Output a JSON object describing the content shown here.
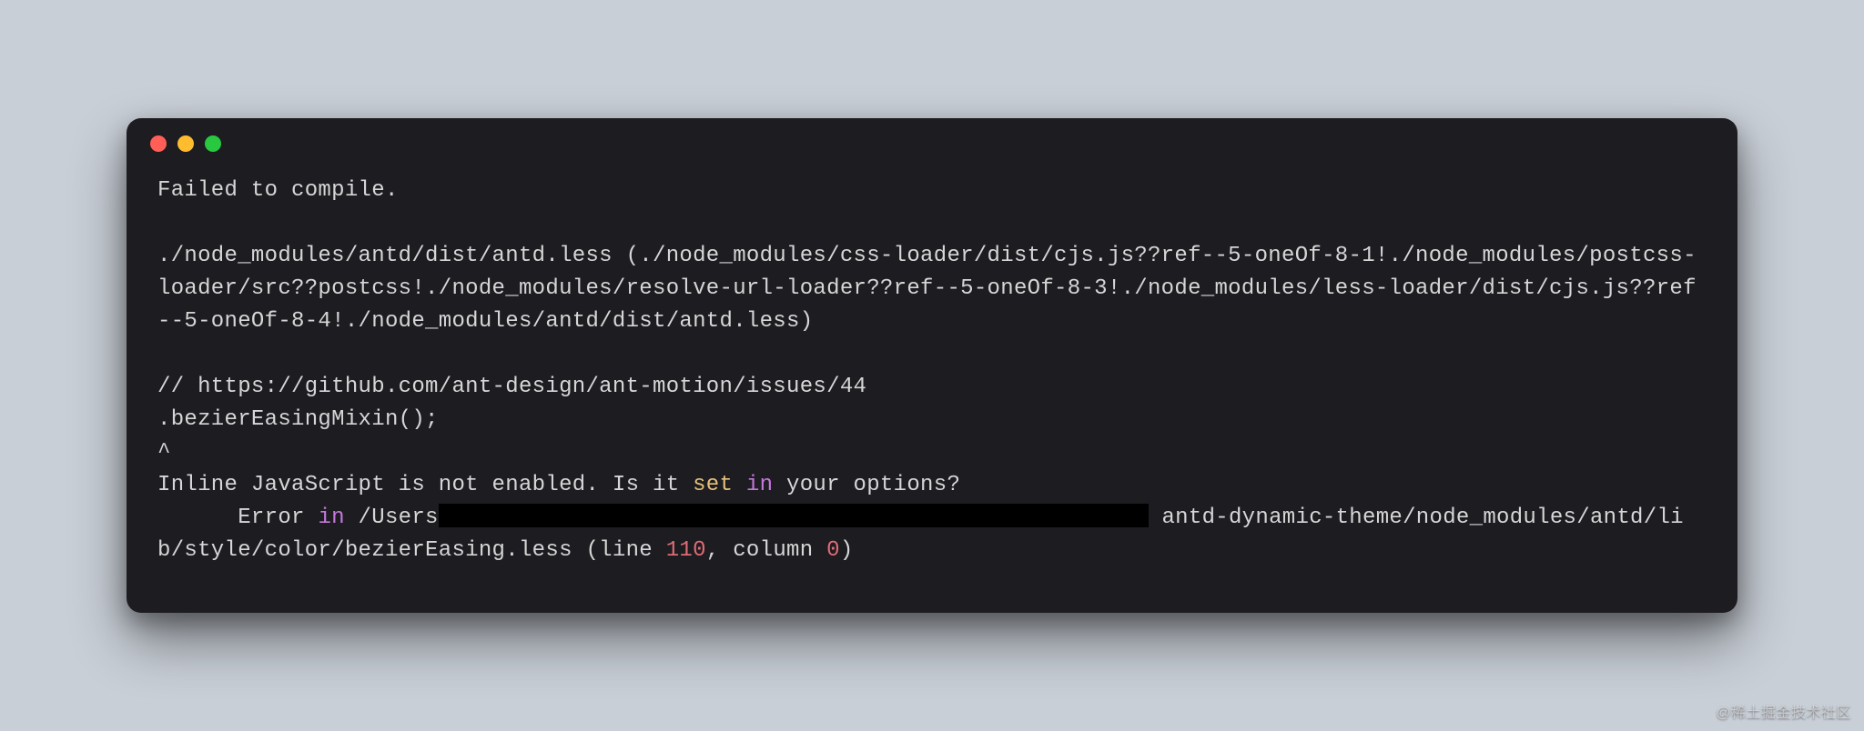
{
  "title_bar": {
    "buttons": [
      "close",
      "minimize",
      "maximize"
    ]
  },
  "terminal": {
    "line1": "Failed to compile.",
    "blank1": "",
    "line2": "./node_modules/antd/dist/antd.less (./node_modules/css-loader/dist/cjs.js??ref--5-oneOf-8-1!./node_modules/postcss-loader/src??postcss!./node_modules/resolve-url-loader??ref--5-oneOf-8-3!./node_modules/less-loader/dist/cjs.js??ref--5-oneOf-8-4!./node_modules/antd/dist/antd.less)",
    "blank2": "",
    "line3": "// https://github.com/ant-design/ant-motion/issues/44",
    "line4": ".bezierEasingMixin();",
    "line5": "^",
    "line6_a": "Inline JavaScript is not enabled. Is it ",
    "line6_set": "set",
    "line6_b": " ",
    "line6_in": "in",
    "line6_c": " your options?",
    "line7_a": "      Error ",
    "line7_in": "in",
    "line7_b": " /Users",
    "line7_c": " antd-dynamic-theme/node_modules/antd/lib/style/color/bezierEasing.less (line ",
    "line7_num1": "110",
    "line7_d": ", column ",
    "line7_num2": "0",
    "line7_e": ")"
  },
  "watermark": "@稀土掘金技术社区"
}
